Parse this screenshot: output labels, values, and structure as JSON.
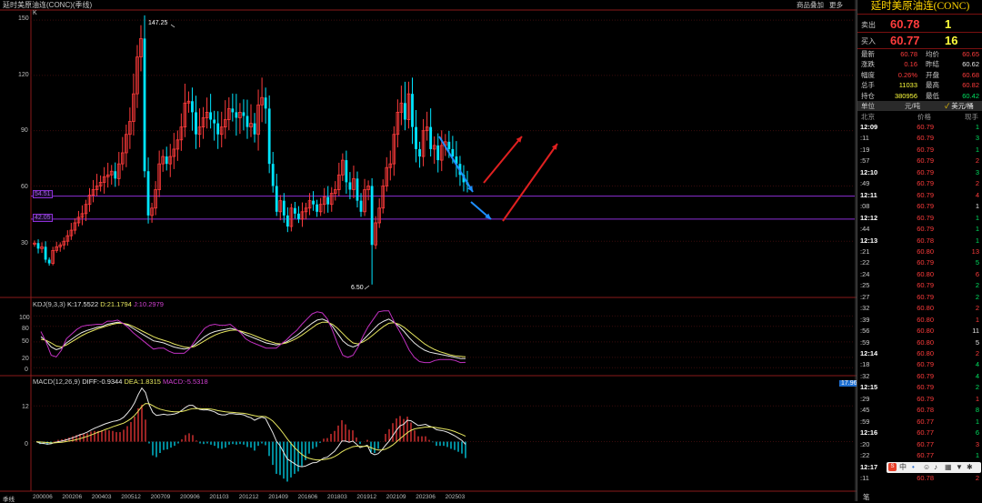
{
  "app": {
    "title": "延时美原油连(CONC)(季线)",
    "link_product_info": "商品叠加",
    "link_more": "更多"
  },
  "main_chart": {
    "y_ticks": [
      "150",
      "120",
      "90",
      "60",
      "30"
    ],
    "x_ticks": [
      "200006",
      "200206",
      "200403",
      "200512",
      "200709",
      "200906",
      "201103",
      "201212",
      "201409",
      "201606",
      "201803",
      "201912",
      "202109",
      "202306",
      "202503"
    ],
    "x_axis_label": "季线",
    "k_label": "K",
    "high_annotation": "147.25",
    "low_annotation": "6.50",
    "level_upper": "54.51",
    "level_lower": "42.05",
    "colors": {
      "up": "#ff3b3b",
      "down": "#00e5ff",
      "level_line": "#8c2fd6",
      "arrow_blue": "#1e8fff",
      "arrow_red": "#e02020"
    }
  },
  "chart_data": [
    {
      "type": "candlestick",
      "title": "延时美原油连(CONC)(季线)",
      "ylim": [
        0,
        155
      ],
      "high": 147.25,
      "low": 6.5,
      "horizontal_lines": [
        54.51,
        42.05
      ],
      "close": [
        29,
        26,
        27,
        20,
        18,
        25,
        27,
        28,
        30,
        33,
        36,
        40,
        43,
        45,
        50,
        55,
        58,
        60,
        62,
        65,
        66,
        68,
        64,
        72,
        78,
        88,
        95,
        110,
        130,
        140,
        68,
        44,
        48,
        58,
        72,
        76,
        72,
        76,
        80,
        85,
        92,
        105,
        106,
        100,
        88,
        92,
        97,
        100,
        96,
        94,
        88,
        92,
        96,
        102,
        100,
        97,
        100,
        98,
        92,
        94,
        88,
        104,
        108,
        102,
        72,
        60,
        46,
        52,
        44,
        38,
        48,
        45,
        42,
        46,
        48,
        52,
        50,
        46,
        50,
        54,
        50,
        56,
        58,
        66,
        74,
        62,
        58,
        64,
        52,
        46,
        58,
        60,
        28,
        40,
        48,
        60,
        70,
        72,
        88,
        100,
        105,
        96,
        110,
        92,
        80,
        76,
        90,
        92,
        80,
        82,
        74,
        82,
        84,
        80,
        76,
        72,
        66,
        62,
        60.78
      ],
      "ylabel": ""
    },
    {
      "type": "line",
      "title": "KDJ(9,3,3)",
      "y_ticks": [
        100,
        80,
        50,
        20,
        0
      ],
      "ylim": [
        -10,
        120
      ],
      "series": [
        {
          "name": "K",
          "last": 17.5522,
          "values": [
            60,
            52,
            40,
            35,
            38,
            48,
            55,
            62,
            68,
            72,
            75,
            78,
            80,
            84,
            86,
            88,
            86,
            82,
            76,
            70,
            64,
            58,
            52,
            50,
            48,
            44,
            40,
            38,
            36,
            38,
            44,
            52,
            60,
            66,
            70,
            72,
            74,
            76,
            74,
            70,
            64,
            60,
            56,
            52,
            48,
            46,
            44,
            46,
            50,
            56,
            62,
            70,
            78,
            86,
            92,
            94,
            90,
            80,
            66,
            52,
            44,
            40,
            44,
            54,
            64,
            74,
            84,
            90,
            94,
            88,
            80,
            70,
            58,
            48,
            40,
            34,
            30,
            28,
            26,
            24,
            22,
            20,
            18,
            17.55
          ]
        },
        {
          "name": "D",
          "last": 21.1794,
          "values": [
            55,
            53,
            48,
            42,
            40,
            44,
            50,
            56,
            62,
            67,
            71,
            75,
            78,
            81,
            84,
            86,
            86,
            84,
            80,
            75,
            70,
            65,
            60,
            56,
            53,
            50,
            46,
            43,
            40,
            39,
            41,
            46,
            52,
            58,
            63,
            67,
            70,
            72,
            73,
            71,
            68,
            65,
            61,
            57,
            53,
            50,
            47,
            46,
            48,
            52,
            57,
            63,
            70,
            77,
            84,
            88,
            88,
            84,
            76,
            66,
            56,
            48,
            46,
            50,
            56,
            64,
            72,
            80,
            86,
            87,
            84,
            78,
            70,
            62,
            54,
            46,
            40,
            35,
            31,
            28,
            25,
            23,
            22,
            21.18
          ]
        },
        {
          "name": "J",
          "last": 10.2979,
          "values": [
            70,
            50,
            24,
            21,
            34,
            56,
            65,
            74,
            80,
            82,
            83,
            84,
            84,
            90,
            90,
            92,
            86,
            78,
            68,
            60,
            52,
            44,
            36,
            38,
            38,
            32,
            28,
            28,
            28,
            36,
            50,
            64,
            76,
            82,
            84,
            82,
            82,
            84,
            76,
            68,
            56,
            50,
            46,
            42,
            38,
            38,
            38,
            46,
            54,
            64,
            72,
            84,
            94,
            104,
            108,
            106,
            94,
            72,
            46,
            24,
            20,
            24,
            40,
            62,
            80,
            94,
            108,
            110,
            110,
            90,
            72,
            54,
            34,
            20,
            12,
            10,
            10,
            14,
            16,
            16,
            16,
            14,
            10,
            10.3
          ]
        }
      ]
    },
    {
      "type": "bar",
      "title": "MACD(12,26,9)",
      "y_ticks": [
        12,
        0
      ],
      "ylim": [
        -16,
        20
      ],
      "series": [
        {
          "name": "DIFF",
          "last": -0.9344
        },
        {
          "name": "DEA",
          "last": 1.8315
        },
        {
          "name": "MACD",
          "last": -5.5318
        }
      ],
      "axis_right_value": "17.96",
      "diff_values": [
        0,
        -0.5,
        -0.6,
        -0.8,
        -0.7,
        -0.3,
        0,
        0.2,
        0.5,
        0.9,
        1.3,
        1.8,
        2.3,
        2.7,
        3.2,
        3.9,
        4.5,
        5.0,
        5.5,
        6.0,
        6.4,
        6.8,
        7.0,
        7.4,
        8.2,
        9.5,
        11.0,
        13.0,
        15.8,
        18.0,
        16.5,
        12.4,
        9.8,
        8.8,
        9.0,
        9.2,
        9.0,
        9.1,
        9.3,
        9.7,
        10.5,
        11.5,
        12.2,
        12.2,
        11.3,
        10.8,
        10.6,
        10.7,
        10.4,
        10.0,
        9.3,
        9.0,
        9.0,
        9.4,
        9.4,
        9.2,
        9.2,
        9.0,
        8.4,
        8.0,
        7.2,
        7.8,
        8.2,
        7.8,
        5.4,
        3.0,
        0.2,
        -1.4,
        -3.6,
        -5.8,
        -6.6,
        -7.4,
        -8.2,
        -8.4,
        -8.2,
        -7.6,
        -7.1,
        -7.0,
        -6.3,
        -5.5,
        -5.2,
        -4.2,
        -3.2,
        -1.6,
        0.2,
        0.2,
        -0.2,
        0.2,
        -0.8,
        -2.0,
        -1.6,
        -1.2,
        -3.8,
        -4.4,
        -4.0,
        -2.8,
        -1.2,
        0.2,
        2.0,
        3.8,
        5.3,
        5.8,
        7.2,
        7.0,
        6.2,
        5.4,
        5.6,
        5.8,
        5.2,
        4.8,
        4.0,
        3.8,
        3.6,
        3.2,
        2.6,
        2.0,
        1.2,
        0.4,
        -0.93
      ],
      "dea_values": [
        0,
        -0.1,
        -0.2,
        -0.3,
        -0.4,
        -0.4,
        -0.3,
        -0.2,
        0,
        0.2,
        0.4,
        0.7,
        1.0,
        1.4,
        1.8,
        2.2,
        2.7,
        3.2,
        3.6,
        4.1,
        4.5,
        5.0,
        5.4,
        5.8,
        6.2,
        6.9,
        7.7,
        8.8,
        10.2,
        11.8,
        12.8,
        12.7,
        12.1,
        11.4,
        10.9,
        10.6,
        10.3,
        10.1,
        10.0,
        10.0,
        10.1,
        10.4,
        10.8,
        11.1,
        11.1,
        11.1,
        11.0,
        11.0,
        10.9,
        10.7,
        10.4,
        10.2,
        10.0,
        9.9,
        9.8,
        9.7,
        9.6,
        9.5,
        9.3,
        9.0,
        8.7,
        8.5,
        8.5,
        8.4,
        7.8,
        6.9,
        5.6,
        4.2,
        2.6,
        0.9,
        -0.6,
        -2.0,
        -3.2,
        -4.3,
        -5.1,
        -5.6,
        -5.9,
        -6.1,
        -6.1,
        -6.0,
        -5.8,
        -5.5,
        -5.0,
        -4.3,
        -3.4,
        -2.7,
        -2.2,
        -1.7,
        -1.5,
        -1.6,
        -1.6,
        -1.5,
        -2.0,
        -2.5,
        -2.8,
        -2.8,
        -2.5,
        -1.9,
        -1.1,
        -0.1,
        1.0,
        2.0,
        3.0,
        3.8,
        4.3,
        4.5,
        4.7,
        4.9,
        4.9,
        4.9,
        4.7,
        4.5,
        4.3,
        4.1,
        3.8,
        3.4,
        2.9,
        2.4,
        1.83
      ]
    }
  ],
  "kdj_panel": {
    "label_name": "KDJ(9,3,3)",
    "label_k": "K:17.5522",
    "label_d": "D:21.1794",
    "label_j": "J:10.2979",
    "y_ticks": [
      "100",
      "80",
      "50",
      "20",
      "0"
    ]
  },
  "macd_panel": {
    "label_name": "MACD(12,26,9)",
    "label_diff": "DIFF:-0.9344",
    "label_dea": "DEA:1.8315",
    "label_macd": "MACD:-5.5318",
    "y_ticks": [
      "12",
      "0"
    ],
    "axis_right_value": "17.96"
  },
  "panel": {
    "title": "延时美原油连(CONC)",
    "ask": {
      "label": "卖出",
      "price": "60.78",
      "volume": "1"
    },
    "bid": {
      "label": "买入",
      "price": "60.77",
      "volume": "16"
    },
    "stats": [
      {
        "l1": "最新",
        "v1": "60.78",
        "c1": "#ff3c3c",
        "l2": "均价",
        "v2": "60.65",
        "c2": "#ff3c3c"
      },
      {
        "l1": "涨跌",
        "v1": "0.16",
        "c1": "#ff3c3c",
        "l2": "昨结",
        "v2": "60.62",
        "c2": "#e8e8e8"
      },
      {
        "l1": "幅度",
        "v1": "0.26%",
        "c1": "#ff3c3c",
        "l2": "开盘",
        "v2": "60.68",
        "c2": "#ff3c3c"
      },
      {
        "l1": "总手",
        "v1": "11033",
        "c1": "#ffff3c",
        "l2": "最高",
        "v2": "60.82",
        "c2": "#ff3c3c"
      },
      {
        "l1": "持仓",
        "v1": "380956",
        "c1": "#ffff3c",
        "l2": "最低",
        "v2": "60.42",
        "c2": "#00e060"
      }
    ],
    "unit": {
      "label": "单位",
      "value": "元/吨",
      "selected": "美元/桶"
    },
    "trade_header": {
      "time": "北京",
      "price": "价格",
      "volume": "现手"
    },
    "trades": [
      {
        "t": "12:09",
        "big": true,
        "p": "60.79",
        "v": "1",
        "vc": "#00e060"
      },
      {
        "t": ":11",
        "big": false,
        "p": "60.79",
        "v": "3",
        "vc": "#00e060"
      },
      {
        "t": ":19",
        "big": false,
        "p": "60.79",
        "v": "1",
        "vc": "#00e060"
      },
      {
        "t": ":57",
        "big": false,
        "p": "60.79",
        "v": "2",
        "vc": "#ff3c3c"
      },
      {
        "t": "12:10",
        "big": true,
        "p": "60.79",
        "v": "3",
        "vc": "#00e060"
      },
      {
        "t": ":49",
        "big": false,
        "p": "60.79",
        "v": "2",
        "vc": "#ff3c3c"
      },
      {
        "t": "12:11",
        "big": true,
        "p": "60.79",
        "v": "4",
        "vc": "#ff3c3c"
      },
      {
        "t": ":08",
        "big": false,
        "p": "60.79",
        "v": "1",
        "vc": "#e8e8e8"
      },
      {
        "t": "12:12",
        "big": true,
        "p": "60.79",
        "v": "1",
        "vc": "#00e060"
      },
      {
        "t": ":44",
        "big": false,
        "p": "60.79",
        "v": "1",
        "vc": "#00e060"
      },
      {
        "t": "12:13",
        "big": true,
        "p": "60.78",
        "v": "1",
        "vc": "#00e060"
      },
      {
        "t": ":21",
        "big": false,
        "p": "60.80",
        "v": "13",
        "vc": "#ff3c3c"
      },
      {
        "t": ":22",
        "big": false,
        "p": "60.79",
        "v": "5",
        "vc": "#00e060"
      },
      {
        "t": ":24",
        "big": false,
        "p": "60.80",
        "v": "6",
        "vc": "#ff3c3c"
      },
      {
        "t": ":25",
        "big": false,
        "p": "60.79",
        "v": "2",
        "vc": "#00e060"
      },
      {
        "t": ":27",
        "big": false,
        "p": "60.79",
        "v": "2",
        "vc": "#00e060"
      },
      {
        "t": ":32",
        "big": false,
        "p": "60.80",
        "v": "2",
        "vc": "#ff3c3c"
      },
      {
        "t": ":39",
        "big": false,
        "p": "60.80",
        "v": "1",
        "vc": "#ff3c3c"
      },
      {
        "t": ":56",
        "big": false,
        "p": "60.80",
        "v": "11",
        "vc": "#e8e8e8"
      },
      {
        "t": ":59",
        "big": false,
        "p": "60.80",
        "v": "5",
        "vc": "#e8e8e8"
      },
      {
        "t": "12:14",
        "big": true,
        "p": "60.80",
        "v": "2",
        "vc": "#ff3c3c"
      },
      {
        "t": ":18",
        "big": false,
        "p": "60.79",
        "v": "4",
        "vc": "#00e060"
      },
      {
        "t": ":32",
        "big": false,
        "p": "60.79",
        "v": "4",
        "vc": "#00e060"
      },
      {
        "t": "12:15",
        "big": true,
        "p": "60.79",
        "v": "2",
        "vc": "#00e060"
      },
      {
        "t": ":29",
        "big": false,
        "p": "60.79",
        "v": "1",
        "vc": "#ff3c3c"
      },
      {
        "t": ":45",
        "big": false,
        "p": "60.78",
        "v": "8",
        "vc": "#00e060"
      },
      {
        "t": ":59",
        "big": false,
        "p": "60.77",
        "v": "1",
        "vc": "#00e060"
      },
      {
        "t": "12:16",
        "big": true,
        "p": "60.77",
        "v": "6",
        "vc": "#00e060"
      },
      {
        "t": ":20",
        "big": false,
        "p": "60.77",
        "v": "3",
        "vc": "#ff3c3c"
      },
      {
        "t": ":22",
        "big": false,
        "p": "60.77",
        "v": "1",
        "vc": "#00e060"
      },
      {
        "t": "12:17",
        "big": true,
        "p": "60.78",
        "v": "1",
        "vc": "#ff3c3c"
      },
      {
        "t": ":11",
        "big": false,
        "p": "60.78",
        "v": "2",
        "vc": "#ff3c3c"
      }
    ],
    "ime_bar": "中",
    "footer_label": "笔"
  }
}
